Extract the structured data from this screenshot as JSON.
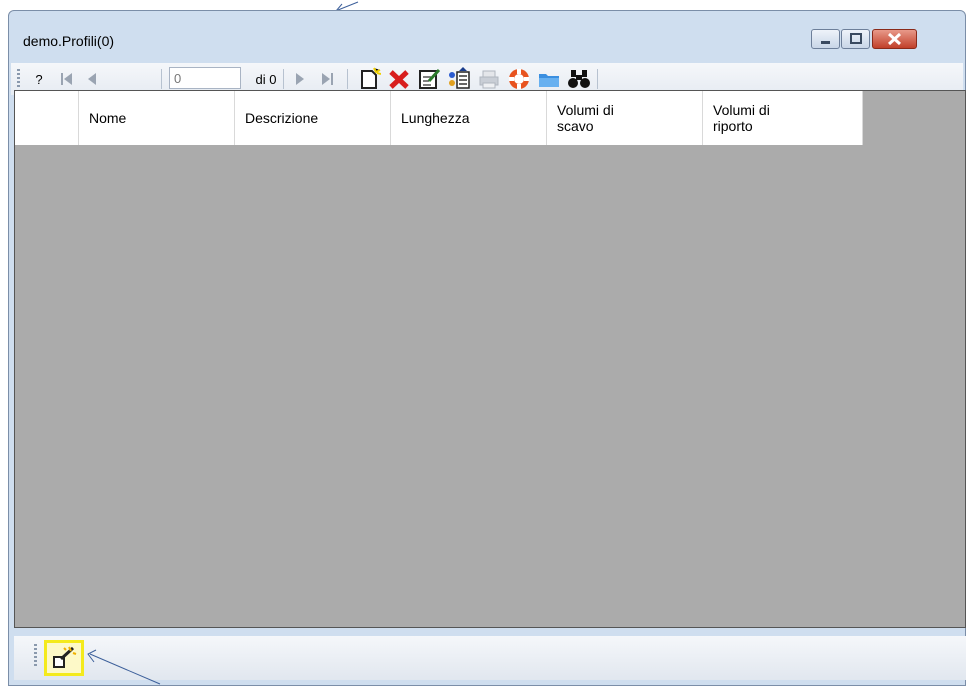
{
  "window": {
    "title": "demo.Profili(0)"
  },
  "toolbar": {
    "help_label": "?",
    "position_value": "0",
    "of_label": "di 0",
    "icons": [
      "help-icon",
      "first-record-icon",
      "prev-record-icon",
      "next-record-icon",
      "last-record-icon",
      "new-document-icon",
      "delete-icon",
      "edit-icon",
      "report-icon",
      "print-icon",
      "lifebuoy-icon",
      "folder-icon",
      "binoculars-icon"
    ]
  },
  "grid": {
    "columns": [
      "",
      "Nome",
      "Descrizione",
      "Lunghezza",
      "Volumi di\nscavo",
      "Volumi di\nriporto"
    ],
    "rows": []
  },
  "bottom": {
    "icons": [
      "magic-wand-icon"
    ]
  },
  "colors": {
    "grid_background": "#ababab",
    "highlight": "#f4ea1c",
    "delete_red": "#d81e1e"
  }
}
